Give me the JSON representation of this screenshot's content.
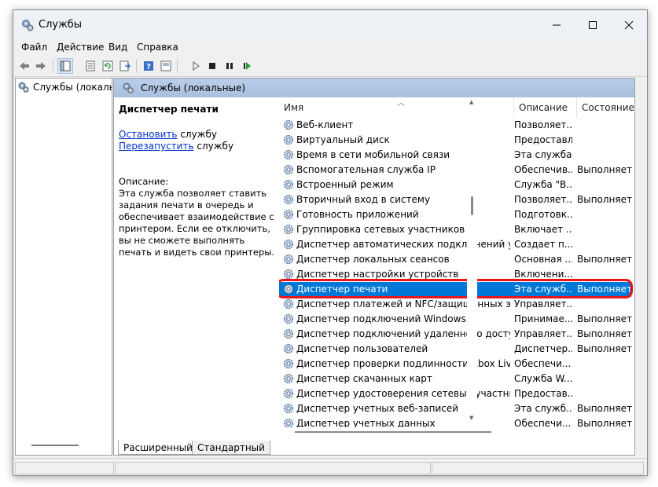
{
  "window": {
    "title": "Службы",
    "icons": {
      "app": "gear-icon",
      "minimize": "minimize-icon",
      "maximize": "maximize-icon",
      "close": "close-icon"
    }
  },
  "menu": [
    "Файл",
    "Действие",
    "Вид",
    "Справка"
  ],
  "toolbar": [
    "back-arrow-icon",
    "forward-arrow-icon",
    "show-tree-icon",
    "properties-icon",
    "refresh-icon",
    "export-icon",
    "help-icon",
    "console-icon",
    "play-icon",
    "stop-icon",
    "pause-icon",
    "resume-icon"
  ],
  "tree": {
    "item": "Службы (локалы"
  },
  "main": {
    "header": "Службы (локальные)",
    "selected_service": "Диспетчер печати",
    "action_stop_link": "Остановить",
    "action_stop_suffix": " службу",
    "action_restart_link": "Перезапустить",
    "action_restart_suffix": " службу",
    "description_label": "Описание:",
    "description_text": "Эта служба позволяет ставить задания печати в очередь и обеспечивает взаимодействие с принтером. Если ее отключить, вы не сможете выполнять печать и видеть свои принтеры."
  },
  "columns": {
    "name": "Имя",
    "description": "Описание",
    "state": "Состояние"
  },
  "rows": [
    {
      "name": "Веб-клиент",
      "description": "Позволяет...",
      "state": ""
    },
    {
      "name": "Виртуальный диск",
      "description": "Предоставл...",
      "state": ""
    },
    {
      "name": "Время в сети мобильной связи",
      "description": "Эта служба...",
      "state": ""
    },
    {
      "name": "Вспомогательная служба IP",
      "description": "Обеспечив...",
      "state": "Выполняетс"
    },
    {
      "name": "Встроенный режим",
      "description": "Служба \"В...",
      "state": ""
    },
    {
      "name": "Вторичный вход в систему",
      "description": "Позволяет...",
      "state": "Выполняетс"
    },
    {
      "name": "Готовность приложений",
      "description": "Подготовк...",
      "state": ""
    },
    {
      "name": "Группировка сетевых участников",
      "description": "Включает ...",
      "state": ""
    },
    {
      "name": "Диспетчер автоматических подключений удал...",
      "description": "Создает п...",
      "state": ""
    },
    {
      "name": "Диспетчер локальных сеансов",
      "description": "Основная ...",
      "state": "Выполняетс"
    },
    {
      "name": "Диспетчер настройки устройств",
      "description": "Включени...",
      "state": ""
    },
    {
      "name": "Диспетчер печати",
      "description": "Эта служб...",
      "state": "Выполняетс"
    },
    {
      "name": "Диспетчер платежей и NFC/защищенных эле...",
      "description": "Управляет...",
      "state": ""
    },
    {
      "name": "Диспетчер подключений Windows",
      "description": "Принимае...",
      "state": "Выполняетс"
    },
    {
      "name": "Диспетчер подключений удаленного доступа",
      "description": "Управляет...",
      "state": "Выполняетс"
    },
    {
      "name": "Диспетчер пользователей",
      "description": "Диспетчер...",
      "state": "Выполняетс"
    },
    {
      "name": "Диспетчер проверки подлинности Xbox Live",
      "description": "Обеспечи...",
      "state": ""
    },
    {
      "name": "Диспетчер скачанных карт",
      "description": "Служба W...",
      "state": ""
    },
    {
      "name": "Диспетчер удостоверения сетевых участников",
      "description": "Предостав...",
      "state": ""
    },
    {
      "name": "Диспетчер учетных веб-записей",
      "description": "Эта служб...",
      "state": "Выполняетс"
    },
    {
      "name": "Диспетчер учетных данных",
      "description": "Обеспечи...",
      "state": "Выполняетс"
    }
  ],
  "selected_row_index": 11,
  "tabs": [
    "Расширенный",
    "Стандартный"
  ]
}
